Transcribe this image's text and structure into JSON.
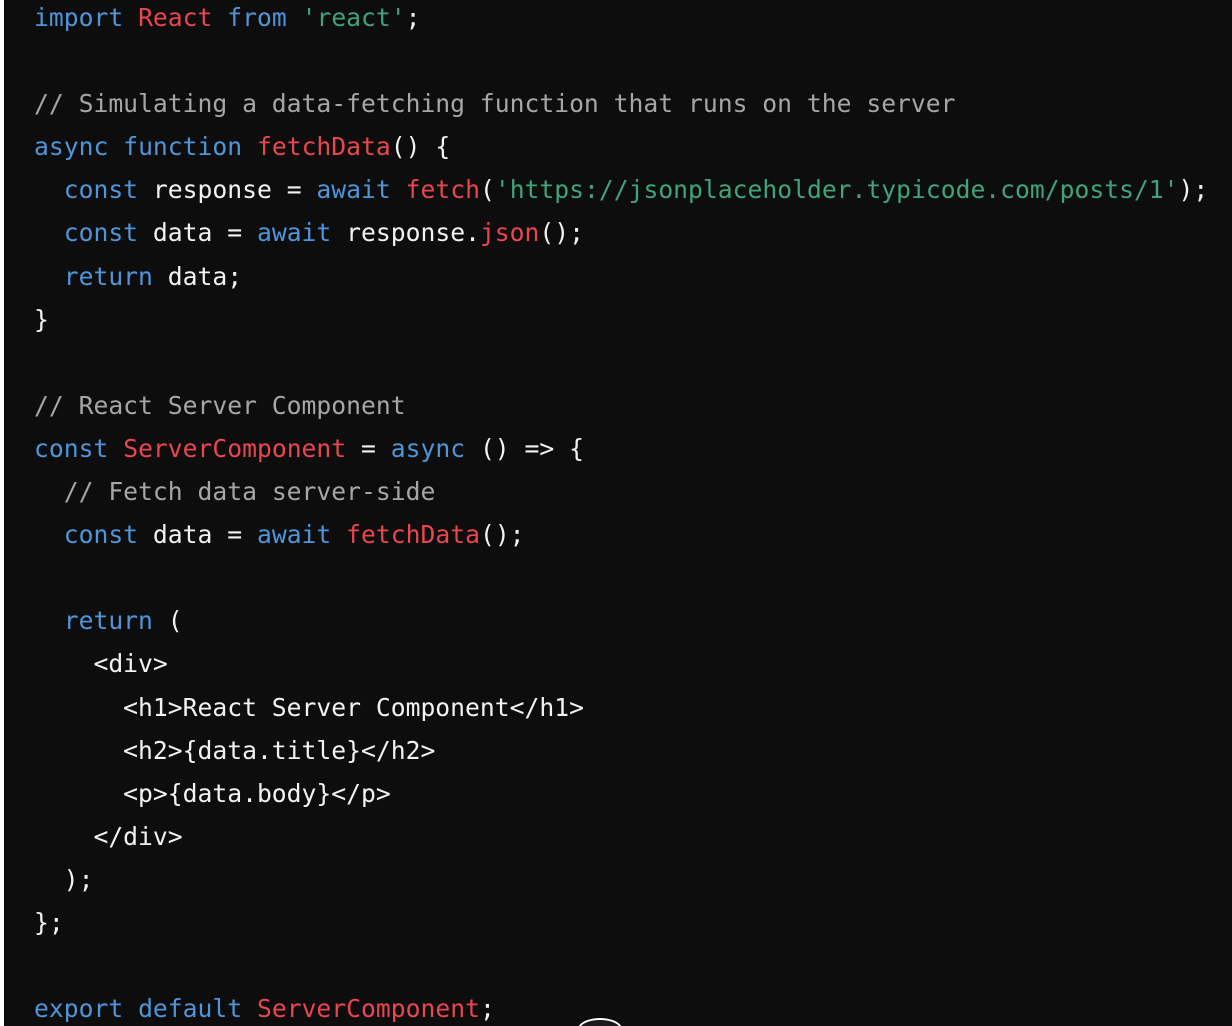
{
  "colors": {
    "background": "#0d0d0d",
    "plain": "#f2f2f2",
    "keyword": "#4f95d9",
    "identifier": "#e9464f",
    "string": "#3fa37c",
    "comment": "#a6a6a6"
  },
  "code": {
    "language": "jsx",
    "lines": [
      [
        [
          "kw",
          "import"
        ],
        [
          "plain",
          " "
        ],
        [
          "id",
          "React"
        ],
        [
          "plain",
          " "
        ],
        [
          "kw",
          "from"
        ],
        [
          "plain",
          " "
        ],
        [
          "str",
          "'react'"
        ],
        [
          "plain",
          ";"
        ]
      ],
      [],
      [
        [
          "cm",
          "// Simulating a data-fetching function that runs on the server"
        ]
      ],
      [
        [
          "kw",
          "async"
        ],
        [
          "plain",
          " "
        ],
        [
          "kw",
          "function"
        ],
        [
          "plain",
          " "
        ],
        [
          "id",
          "fetchData"
        ],
        [
          "plain",
          "() {"
        ]
      ],
      [
        [
          "plain",
          "  "
        ],
        [
          "kw",
          "const"
        ],
        [
          "plain",
          " response = "
        ],
        [
          "kw",
          "await"
        ],
        [
          "plain",
          " "
        ],
        [
          "id",
          "fetch"
        ],
        [
          "plain",
          "("
        ],
        [
          "str",
          "'https://jsonplaceholder.typicode.com/posts/1'"
        ],
        [
          "plain",
          ");"
        ]
      ],
      [
        [
          "plain",
          "  "
        ],
        [
          "kw",
          "const"
        ],
        [
          "plain",
          " data = "
        ],
        [
          "kw",
          "await"
        ],
        [
          "plain",
          " response."
        ],
        [
          "id",
          "json"
        ],
        [
          "plain",
          "();"
        ]
      ],
      [
        [
          "plain",
          "  "
        ],
        [
          "kw",
          "return"
        ],
        [
          "plain",
          " data;"
        ]
      ],
      [
        [
          "plain",
          "}"
        ]
      ],
      [],
      [
        [
          "cm",
          "// React Server Component"
        ]
      ],
      [
        [
          "kw",
          "const"
        ],
        [
          "plain",
          " "
        ],
        [
          "id",
          "ServerComponent"
        ],
        [
          "plain",
          " = "
        ],
        [
          "kw",
          "async"
        ],
        [
          "plain",
          " () => {"
        ]
      ],
      [
        [
          "plain",
          "  "
        ],
        [
          "cm",
          "// Fetch data server-side"
        ]
      ],
      [
        [
          "plain",
          "  "
        ],
        [
          "kw",
          "const"
        ],
        [
          "plain",
          " data = "
        ],
        [
          "kw",
          "await"
        ],
        [
          "plain",
          " "
        ],
        [
          "id",
          "fetchData"
        ],
        [
          "plain",
          "();"
        ]
      ],
      [],
      [
        [
          "plain",
          "  "
        ],
        [
          "kw",
          "return"
        ],
        [
          "plain",
          " ("
        ]
      ],
      [
        [
          "plain",
          "    <div>"
        ]
      ],
      [
        [
          "plain",
          "      <h1>React Server Component</h1>"
        ]
      ],
      [
        [
          "plain",
          "      <h2>{data.title}</h2>"
        ]
      ],
      [
        [
          "plain",
          "      <p>{data.body}</p>"
        ]
      ],
      [
        [
          "plain",
          "    </div>"
        ]
      ],
      [
        [
          "plain",
          "  );"
        ]
      ],
      [
        [
          "plain",
          "};"
        ]
      ],
      [],
      [
        [
          "kw",
          "export"
        ],
        [
          "plain",
          " "
        ],
        [
          "kw",
          "default"
        ],
        [
          "plain",
          " "
        ],
        [
          "id",
          "ServerComponent"
        ],
        [
          "plain",
          ";"
        ]
      ]
    ]
  }
}
